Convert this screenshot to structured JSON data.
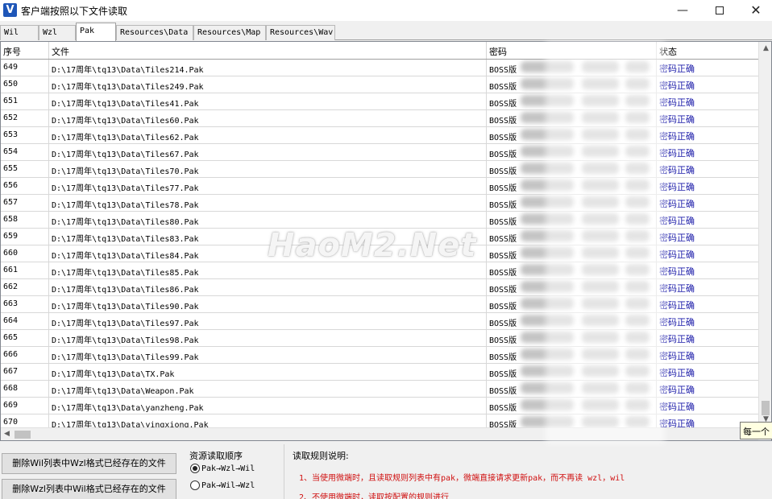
{
  "window": {
    "icon_text": "V",
    "title": "客户端按照以下文件读取",
    "minimize_icon": "—",
    "close_icon": "✕"
  },
  "tabs": [
    {
      "label": "Wil",
      "active": false
    },
    {
      "label": "Wzl",
      "active": false
    },
    {
      "label": "Pak",
      "active": true
    },
    {
      "label": "Resources\\Data",
      "active": false
    },
    {
      "label": "Resources\\Map",
      "active": false
    },
    {
      "label": "Resources\\Wav",
      "active": false
    }
  ],
  "table": {
    "columns": [
      "序号",
      "文件",
      "密码",
      "状态"
    ],
    "rows": [
      {
        "no": "649",
        "file": "D:\\17周年\\tq13\\Data\\Tiles214.Pak",
        "pwd": "BOSS版",
        "status": "密码正确"
      },
      {
        "no": "650",
        "file": "D:\\17周年\\tq13\\Data\\Tiles249.Pak",
        "pwd": "BOSS版",
        "status": "密码正确"
      },
      {
        "no": "651",
        "file": "D:\\17周年\\tq13\\Data\\Tiles41.Pak",
        "pwd": "BOSS版",
        "status": "密码正确"
      },
      {
        "no": "652",
        "file": "D:\\17周年\\tq13\\Data\\Tiles60.Pak",
        "pwd": "BOSS版",
        "status": "密码正确"
      },
      {
        "no": "653",
        "file": "D:\\17周年\\tq13\\Data\\Tiles62.Pak",
        "pwd": "BOSS版",
        "status": "密码正确"
      },
      {
        "no": "654",
        "file": "D:\\17周年\\tq13\\Data\\Tiles67.Pak",
        "pwd": "BOSS版",
        "status": "密码正确"
      },
      {
        "no": "655",
        "file": "D:\\17周年\\tq13\\Data\\Tiles70.Pak",
        "pwd": "BOSS版",
        "status": "密码正确"
      },
      {
        "no": "656",
        "file": "D:\\17周年\\tq13\\Data\\Tiles77.Pak",
        "pwd": "BOSS版",
        "status": "密码正确"
      },
      {
        "no": "657",
        "file": "D:\\17周年\\tq13\\Data\\Tiles78.Pak",
        "pwd": "BOSS版",
        "status": "密码正确"
      },
      {
        "no": "658",
        "file": "D:\\17周年\\tq13\\Data\\Tiles80.Pak",
        "pwd": "BOSS版",
        "status": "密码正确"
      },
      {
        "no": "659",
        "file": "D:\\17周年\\tq13\\Data\\Tiles83.Pak",
        "pwd": "BOSS版",
        "status": "密码正确"
      },
      {
        "no": "660",
        "file": "D:\\17周年\\tq13\\Data\\Tiles84.Pak",
        "pwd": "BOSS版",
        "status": "密码正确"
      },
      {
        "no": "661",
        "file": "D:\\17周年\\tq13\\Data\\Tiles85.Pak",
        "pwd": "BOSS版",
        "status": "密码正确"
      },
      {
        "no": "662",
        "file": "D:\\17周年\\tq13\\Data\\Tiles86.Pak",
        "pwd": "BOSS版",
        "status": "密码正确"
      },
      {
        "no": "663",
        "file": "D:\\17周年\\tq13\\Data\\Tiles90.Pak",
        "pwd": "BOSS版",
        "status": "密码正确"
      },
      {
        "no": "664",
        "file": "D:\\17周年\\tq13\\Data\\Tiles97.Pak",
        "pwd": "BOSS版",
        "status": "密码正确"
      },
      {
        "no": "665",
        "file": "D:\\17周年\\tq13\\Data\\Tiles98.Pak",
        "pwd": "BOSS版",
        "status": "密码正确"
      },
      {
        "no": "666",
        "file": "D:\\17周年\\tq13\\Data\\Tiles99.Pak",
        "pwd": "BOSS版",
        "status": "密码正确"
      },
      {
        "no": "667",
        "file": "D:\\17周年\\tq13\\Data\\TX.Pak",
        "pwd": "BOSS版",
        "status": "密码正确"
      },
      {
        "no": "668",
        "file": "D:\\17周年\\tq13\\Data\\Weapon.Pak",
        "pwd": "BOSS版",
        "status": "密码正确"
      },
      {
        "no": "669",
        "file": "D:\\17周年\\tq13\\Data\\yanzheng.Pak",
        "pwd": "BOSS版",
        "status": "密码正确"
      },
      {
        "no": "670",
        "file": "D:\\17周年\\tq13\\Data\\yingxiong.Pak",
        "pwd": "BOSS版",
        "status": "密码正确"
      }
    ]
  },
  "watermark": "HaoM2.Net",
  "tooltip": "每一个",
  "buttons": {
    "delete_wil": "删除Wil列表中Wzl格式已经存在的文件",
    "delete_wzl": "删除Wzl列表中Wil格式已经存在的文件"
  },
  "resource_order": {
    "title": "资源读取顺序",
    "options": [
      {
        "label": "Pak→Wzl→Wil",
        "selected": true
      },
      {
        "label": "Pak→Wil→Wzl",
        "selected": false
      }
    ]
  },
  "rules": {
    "title": "读取规则说明:",
    "items": [
      "1、当使用微端时，且读取规则列表中有pak，微端直接请求更新pak，而不再读 wzl，wil",
      "2、不使用微端时，读取按配置的规则进行"
    ]
  },
  "colors": {
    "status_text": "#1a1aa8",
    "rule_text": "#d01010",
    "app_icon": "#1e56b8"
  }
}
